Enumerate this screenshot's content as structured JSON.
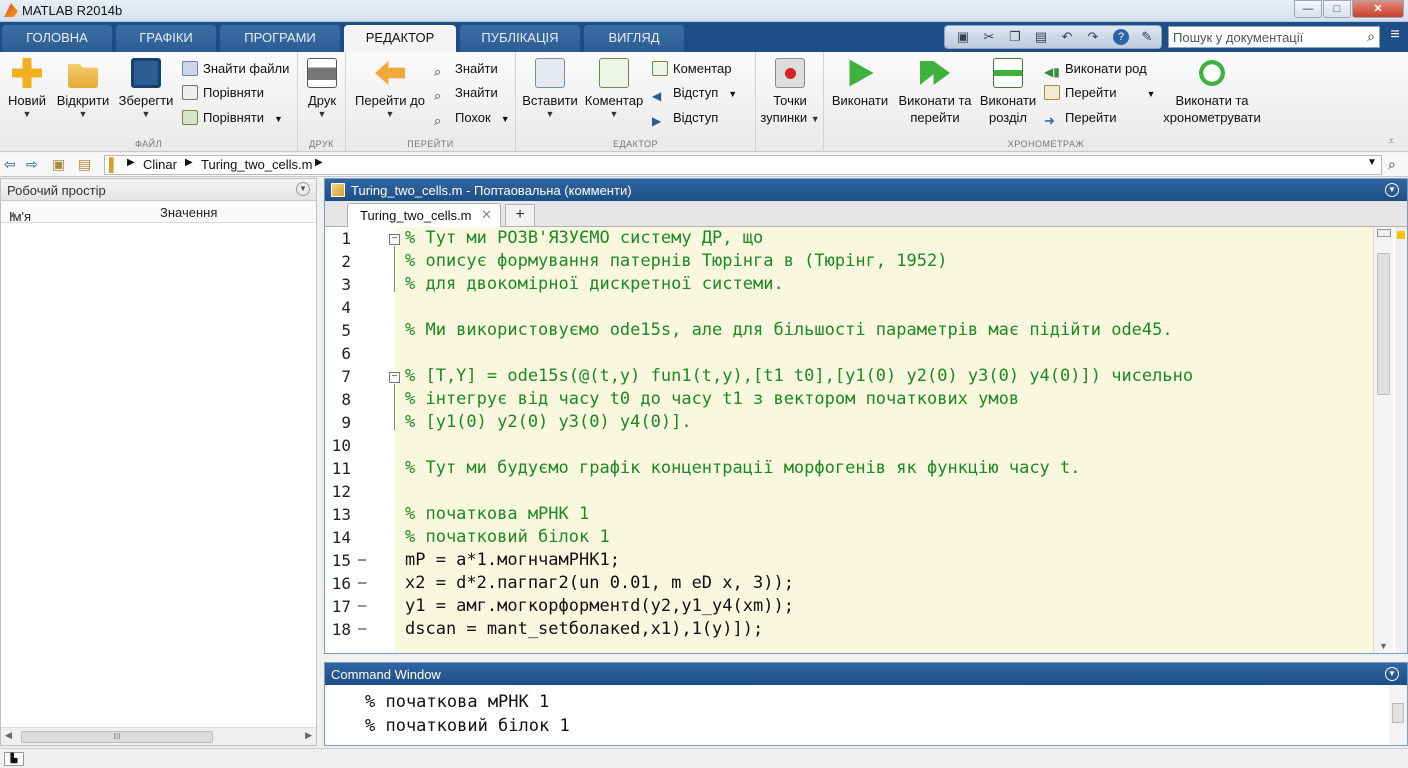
{
  "window": {
    "title": "MATLAB R2014b",
    "minimize": "—",
    "maximize": "□",
    "close": "✕"
  },
  "tabs": [
    {
      "label": "ГОЛОВНА"
    },
    {
      "label": "ГРАФІКИ"
    },
    {
      "label": "ПРОГРАМИ"
    },
    {
      "label": "РЕДАКТОР"
    },
    {
      "label": "ПУБЛІКАЦІЯ"
    },
    {
      "label": "ВИГЛЯД"
    }
  ],
  "search": {
    "placeholder": "Пошук у документації"
  },
  "ribbon": {
    "file": {
      "new": "Новий",
      "open": "Відкрити",
      "save": "Зберегти",
      "find_files": "Знайти файли",
      "compare1": "Порівняти",
      "compare2": "Порівняти",
      "group": "ФАЙЛ"
    },
    "print": {
      "print": "Друк",
      "group": "ДРУК"
    },
    "navigate": {
      "goto": "Перейти до",
      "find1": "Знайти",
      "find2": "Знайти",
      "bookmark": "Похок",
      "group": "ПЕРЕЙТИ"
    },
    "edit": {
      "insert": "Вставити",
      "comment_big": "Коментар",
      "comment": "Коментар",
      "indent1": "Відступ",
      "indent2": "Відступ",
      "group": "ЕДАКТОР"
    },
    "breakpoints": {
      "label1": "Точки",
      "label2": "зупинки"
    },
    "run": {
      "run": "Виконати",
      "run_adv1": "Виконати та",
      "run_adv2": "перейти",
      "run_sec1": "Виконати",
      "run_sec2": "розділ",
      "run_rod": "Виконати род",
      "adv1": "Перейти",
      "adv2": "Перейти",
      "time1": "Виконати та",
      "time2": "хронометрувати",
      "group": "ХРОНОМЕТРАЖ"
    }
  },
  "path": {
    "seg1": "Clinar",
    "seg2": "Turing_two_cells.m"
  },
  "workspace": {
    "title": "Робочий простір",
    "col_name": "Ім'я",
    "col_value": "Значення",
    "scroll_mark": "III"
  },
  "editor": {
    "title": "Turing_two_cells.m - Поптаовальна (комменти)",
    "file_tab": "Turing_two_cells.m",
    "add_tab": "+",
    "lines": [
      {
        "num": "1",
        "text": "% Тут ми РОЗВ'ЯЗУЄМО систему ДР, що",
        "comment": true
      },
      {
        "num": "2",
        "text": "% описує формування патернів Тюрінга в (Тюрінг, 1952)",
        "comment": true
      },
      {
        "num": "3",
        "text": "% для двокомірної дискретної системи.",
        "comment": true
      },
      {
        "num": "4",
        "text": "",
        "comment": true
      },
      {
        "num": "5",
        "text": "% Ми використовуємо ode15s, але для більшості параметрів має підійти ode45.",
        "comment": true
      },
      {
        "num": "6",
        "text": "",
        "comment": true
      },
      {
        "num": "7",
        "text": "% [T,Y] = ode15s(@(t,y) fun1(t,y),[t1 t0],[y1(0) y2(0) y3(0) y4(0)]) чисельно",
        "comment": true
      },
      {
        "num": "8",
        "text": "% інтегрує від часу t0 до часу t1 з вектором початкових умов",
        "comment": true
      },
      {
        "num": "9",
        "text": "% [y1(0) y2(0) y3(0) y4(0)].",
        "comment": true
      },
      {
        "num": "10",
        "text": "",
        "comment": true
      },
      {
        "num": "11",
        "text": "% Тут ми будуємо графік концентрації морфогенів як функцію часу t.",
        "comment": true
      },
      {
        "num": "12",
        "text": "",
        "comment": true
      },
      {
        "num": "13",
        "text": "% початкова мРНК 1",
        "comment": true
      },
      {
        "num": "14",
        "text": "% початковий білок 1",
        "comment": true
      },
      {
        "num": "15",
        "text": "mP = a*1.могнчамРНК1;",
        "comment": false
      },
      {
        "num": "16",
        "text": "x2 = d*2.пагпаг2(un 0.01, m eD x, 3));",
        "comment": false
      },
      {
        "num": "17",
        "text": "y1 = амг.могкорформентd(y2,y1_y4(xm));",
        "comment": false
      },
      {
        "num": "18",
        "text": "dscan = mant_setболакеd,x1),1(y)]);",
        "comment": false
      }
    ]
  },
  "command_window": {
    "title": "Command Window",
    "lines": [
      "% початкова мРНК 1",
      "% початковий білок 1"
    ]
  },
  "colors": {
    "accent": "#1d4f86",
    "comment": "#1c8a24",
    "cell_bg": "#f9f7de"
  }
}
